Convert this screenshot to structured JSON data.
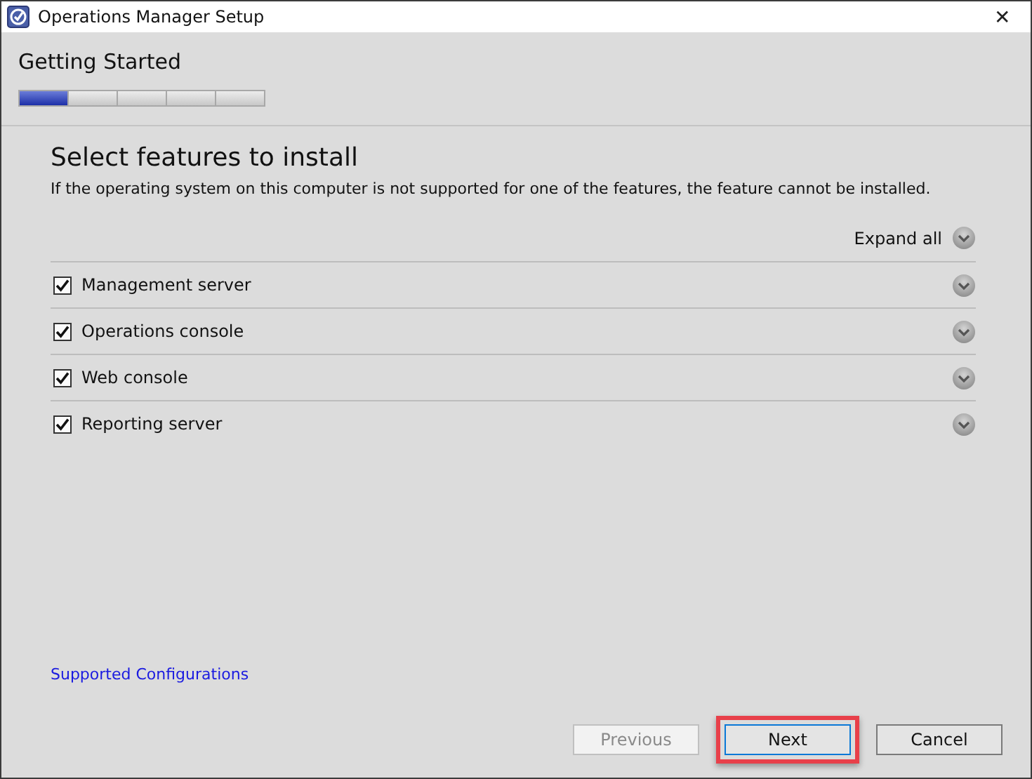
{
  "window": {
    "title": "Operations Manager Setup",
    "close": "✕"
  },
  "header": {
    "title": "Getting Started",
    "steps": [
      {
        "selected": true
      },
      {
        "selected": false
      },
      {
        "selected": false
      },
      {
        "selected": false
      },
      {
        "selected": false
      }
    ]
  },
  "page": {
    "heading": "Select features to install",
    "description": "If the operating system on this computer is not supported for one of the features, the feature cannot be installed.",
    "expand_all": "Expand all"
  },
  "features": [
    {
      "label": "Management server",
      "checked": true
    },
    {
      "label": "Operations console",
      "checked": true
    },
    {
      "label": "Web console",
      "checked": true
    },
    {
      "label": "Reporting server",
      "checked": true
    }
  ],
  "link": "Supported Configurations",
  "buttons": [
    {
      "label": "Previous",
      "disabled": true,
      "highlighted": false
    },
    {
      "label": "Next",
      "disabled": false,
      "highlighted": true
    },
    {
      "label": "Cancel",
      "disabled": false,
      "highlighted": false
    }
  ]
}
